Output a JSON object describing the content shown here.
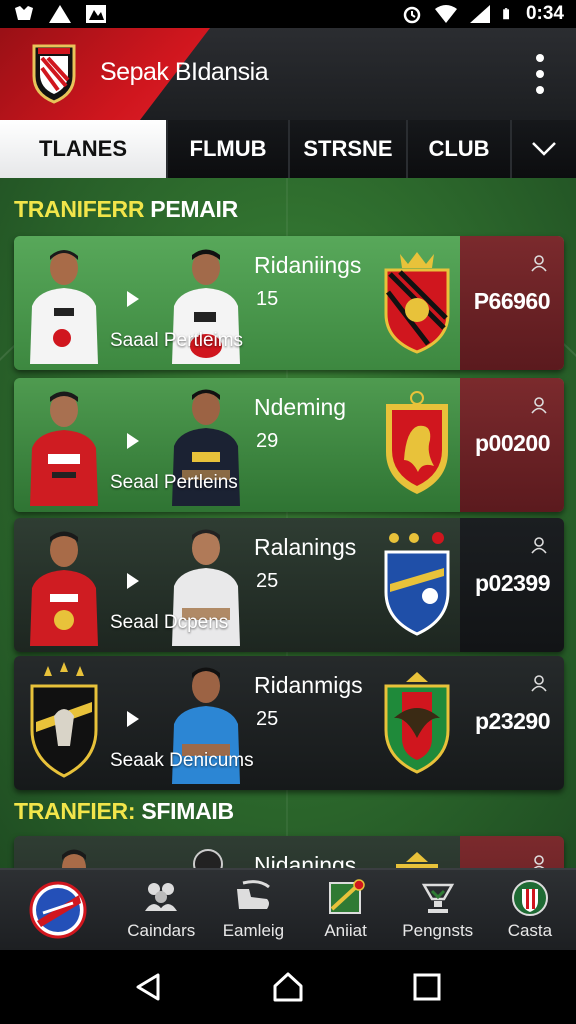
{
  "status_bar": {
    "time": "0:34"
  },
  "app": {
    "title": "Sepak BIdansia"
  },
  "tabs": [
    {
      "label": "TLANES",
      "active": true
    },
    {
      "label": "FLMUB",
      "active": false
    },
    {
      "label": "STRSNE",
      "active": false
    },
    {
      "label": "CLUB",
      "active": false
    }
  ],
  "sections": [
    {
      "title_highlight": "TRANIFERR",
      "title_rest": " PEMAIR"
    },
    {
      "title_highlight": "TRANFIER:",
      "title_rest": " SFIMAIB"
    }
  ],
  "transfers": [
    {
      "name": "Ridaniings",
      "number": "15",
      "subtitle": "Saaal Pertleims",
      "price": "P66960"
    },
    {
      "name": "Ndeming",
      "number": "29",
      "subtitle": "Seaal Pertleins",
      "price": "p00200"
    },
    {
      "name": "Ralanings",
      "number": "25",
      "subtitle": "Seaal Dcpens",
      "price": "p02399"
    },
    {
      "name": "Ridanmigs",
      "number": "25",
      "subtitle": "Seaak Denicums",
      "price": "p23290"
    },
    {
      "name": "Nidanings",
      "number": "",
      "subtitle": "",
      "price": ""
    }
  ],
  "bottom_nav": [
    {
      "label": "",
      "icon": "club-badge-icon"
    },
    {
      "label": "Caindars",
      "icon": "people-icon"
    },
    {
      "label": "Eamleig",
      "icon": "boot-icon"
    },
    {
      "label": "Aniiat",
      "icon": "flag-icon"
    },
    {
      "label": "Pengnsts",
      "icon": "trophy-icon"
    },
    {
      "label": "Casta",
      "icon": "shield-badge-icon"
    }
  ],
  "colors": {
    "accent_red": "#d0161e",
    "highlight_yellow": "#f2e54a",
    "pitch_green": "#3f8a3a"
  }
}
